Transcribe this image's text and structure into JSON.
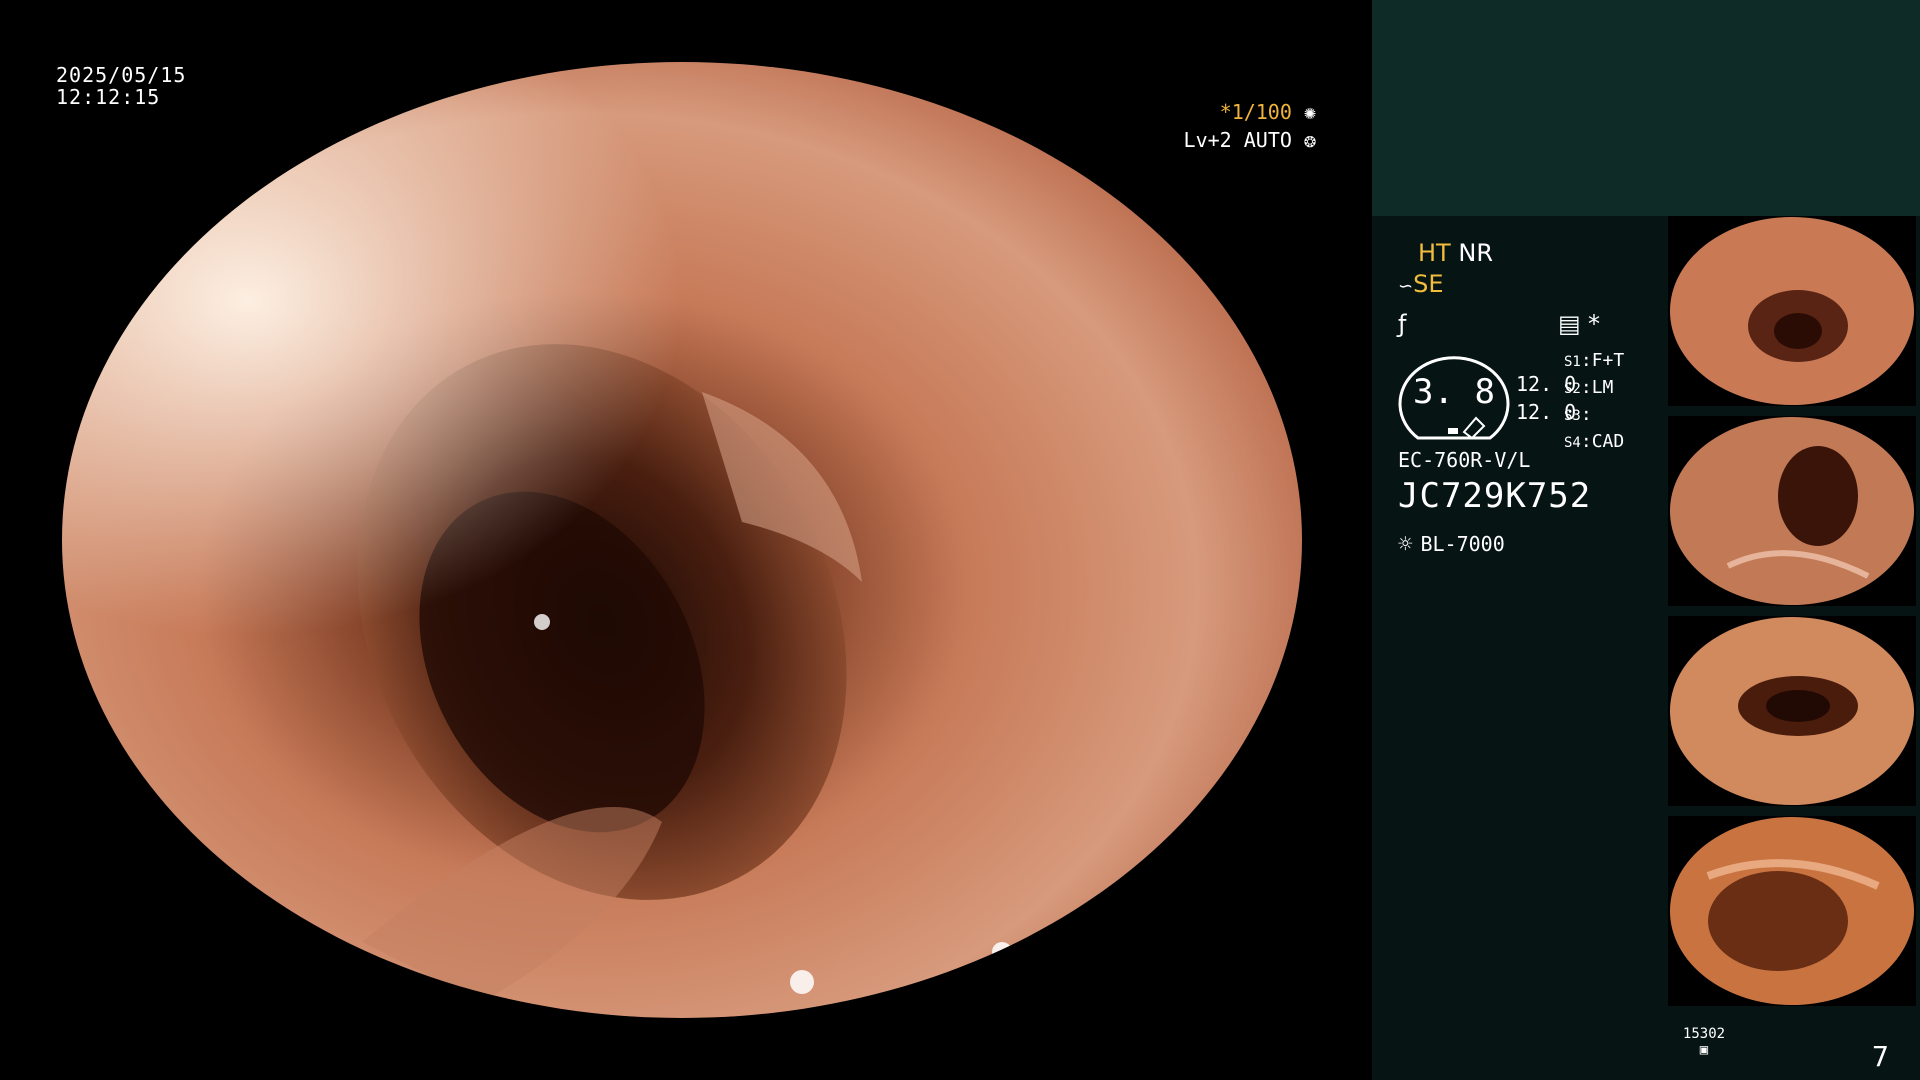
{
  "overlay": {
    "date": "2025/05/15",
    "time": "12:12:15",
    "shutter_star": "*",
    "shutter": "1/100",
    "level": "Lv+2 AUTO"
  },
  "panel": {
    "mode_ht": "HT",
    "mode_nr": "NR",
    "mode_se": "SE",
    "asterisk": "*",
    "gauge_value": "3. 8",
    "gauge_num1": "12. 0",
    "gauge_num2": "12. 0",
    "s1_label": "S1",
    "s1_value": "F+T",
    "s2_label": "S2",
    "s2_value": "LM",
    "s3_label": "S3",
    "s3_value": "",
    "s4_label": "S4",
    "s4_value": "CAD",
    "scope_model": "EC-760R-V/L",
    "scope_serial": "JC729K752",
    "light_source": "BL-7000"
  },
  "footer": {
    "count": "15302",
    "page": "7"
  },
  "colors": {
    "accent_yellow": "#f2bd3c",
    "panel_bg": "#061413",
    "panel_top": "#0f2b28"
  }
}
